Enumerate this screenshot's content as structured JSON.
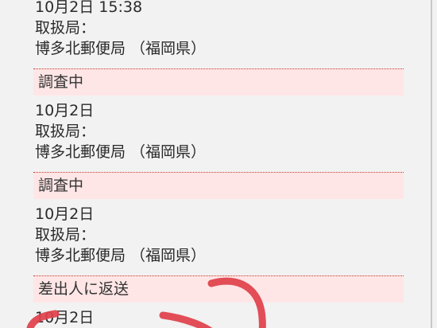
{
  "entries": [
    {
      "status": "",
      "date": "10月2日 15:38",
      "office_label": "取扱局：",
      "office": "博多北郵便局 （福岡県）"
    },
    {
      "status": "調査中",
      "date": "10月2日",
      "office_label": "取扱局：",
      "office": "博多北郵便局 （福岡県）"
    },
    {
      "status": "調査中",
      "date": "10月2日",
      "office_label": "取扱局：",
      "office": "博多北郵便局 （福岡県）"
    },
    {
      "status": "差出人に返送",
      "date": "10月2日",
      "office_label": "",
      "office": ""
    }
  ],
  "colors": {
    "status_bg": "#ffe6e6",
    "status_border": "#c0392b",
    "annotation_stroke": "#e0404a"
  }
}
